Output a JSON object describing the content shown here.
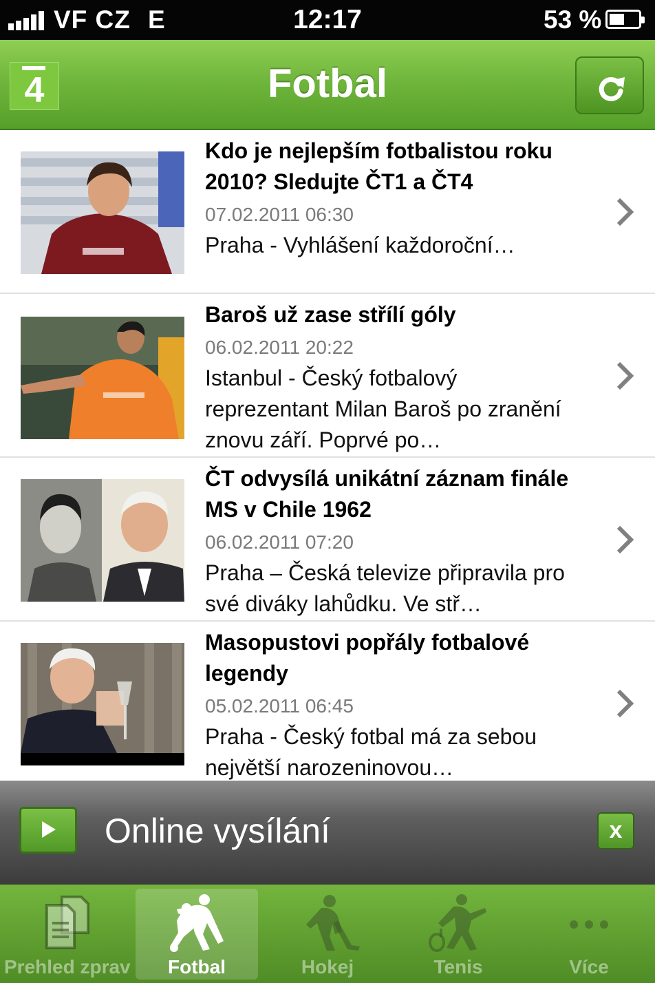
{
  "status_bar": {
    "carrier": "VF CZ",
    "network": "E",
    "time": "12:17",
    "battery_percent": "53 %",
    "battery_level": 0.53,
    "signal_bars": 5
  },
  "nav": {
    "logo_text": "4",
    "title": "Fotbal",
    "refresh_icon": "refresh-icon"
  },
  "articles": [
    {
      "title": "Kdo je nejlepším fotbalistou roku 2010? Sledujte ČT1 a ČT4",
      "date": "07.02.2011  06:30",
      "summary": "Praha - Vyhlášení každoroční…"
    },
    {
      "title": "Baroš už zase střílí góly",
      "date": "06.02.2011  20:22",
      "summary": "Istanbul - Český fotbalový reprezentant Milan Baroš po zranění znovu září. Poprvé po…"
    },
    {
      "title": "ČT odvysílá unikátní záznam finále MS v Chile 1962",
      "date": "06.02.2011  07:20",
      "summary": "Praha – Česká televize připravila pro své diváky lahůdku. Ve stř…"
    },
    {
      "title": "Masopustovi popřály fotbalové legendy",
      "date": "05.02.2011  06:45",
      "summary": "Praha - Český fotbal má za sebou největší narozeninovou…"
    }
  ],
  "online_bar": {
    "label": "Online vysílání",
    "close_label": "x",
    "play_icon": "play-icon"
  },
  "tabs": [
    {
      "label": "Prehled zprav",
      "icon": "documents-icon",
      "active": false
    },
    {
      "label": "Fotbal",
      "icon": "football-players-icon",
      "active": true
    },
    {
      "label": "Hokej",
      "icon": "hockey-player-icon",
      "active": false
    },
    {
      "label": "Tenis",
      "icon": "tennis-player-icon",
      "active": false
    },
    {
      "label": "Více",
      "icon": "more-dots-icon",
      "active": false
    }
  ],
  "colors": {
    "brand_green": "#6db43a",
    "active_tab_label": "#ffffff"
  }
}
